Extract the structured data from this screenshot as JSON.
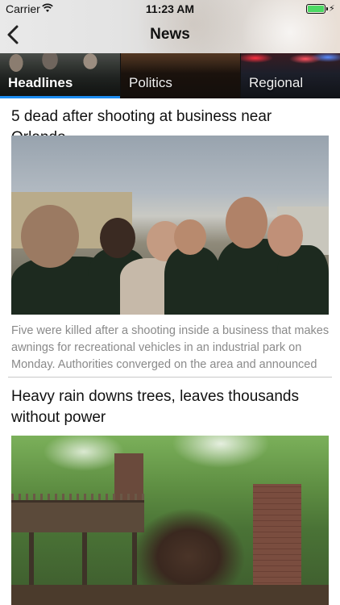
{
  "status_bar": {
    "carrier": "Carrier",
    "time": "11:23 AM",
    "battery_color": "#4cd964"
  },
  "nav": {
    "title": "News",
    "back_icon": "chevron-left-icon"
  },
  "tabs": [
    {
      "label": "Headlines",
      "selected": true
    },
    {
      "label": "Politics",
      "selected": false
    },
    {
      "label": "Regional",
      "selected": false
    }
  ],
  "accent_color": "#1d8cf0",
  "articles": [
    {
      "title": "5 dead after shooting at business near Orlando",
      "summary": "Five were killed after a shooting inside a business that makes awnings for recreational vehicles in an industrial park on Monday. Authorities converged on the area and announced"
    },
    {
      "title": "Heavy rain downs trees, leaves thousands without power",
      "summary": ""
    }
  ]
}
